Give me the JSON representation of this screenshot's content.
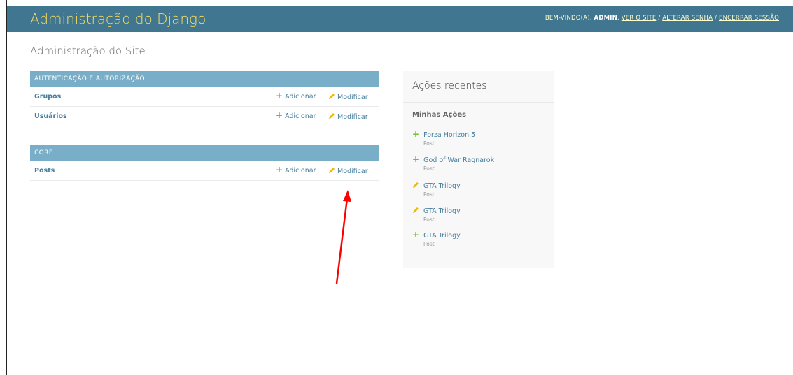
{
  "header": {
    "brand": "Administração do Django",
    "welcome": "BEM-VINDO(A),",
    "user": "ADMIN",
    "view_site": "VER O SITE",
    "change_password": "ALTERAR SENHA",
    "logout": "ENCERRAR SESSÃO"
  },
  "page_title": "Administração do Site",
  "apps": [
    {
      "caption": "AUTENTICAÇÃO E AUTORIZAÇÃO",
      "models": [
        {
          "name": "Grupos",
          "add": "Adicionar",
          "change": "Modificar"
        },
        {
          "name": "Usuários",
          "add": "Adicionar",
          "change": "Modificar"
        }
      ]
    },
    {
      "caption": "CORE",
      "models": [
        {
          "name": "Posts",
          "add": "Adicionar",
          "change": "Modificar"
        }
      ]
    }
  ],
  "recent_actions": {
    "title": "Ações recentes",
    "subtitle": "Minhas Ações",
    "items": [
      {
        "icon": "plus-icon",
        "name": "Forza Horizon 5",
        "type": "Post"
      },
      {
        "icon": "plus-icon",
        "name": "God of War Ragnarok",
        "type": "Post"
      },
      {
        "icon": "pencil-icon",
        "name": "GTA Trilogy",
        "type": "Post"
      },
      {
        "icon": "pencil-icon",
        "name": "GTA Trilogy",
        "type": "Post"
      },
      {
        "icon": "plus-icon",
        "name": "GTA Trilogy",
        "type": "Post"
      }
    ]
  },
  "colors": {
    "header_bg": "#417690",
    "brand": "#f5dd5d",
    "caption_bg": "#79aec8",
    "link": "#447e9b",
    "add_green": "#70bf2b",
    "change_yellow": "#efb80b",
    "annotation_arrow": "#ff0000"
  }
}
